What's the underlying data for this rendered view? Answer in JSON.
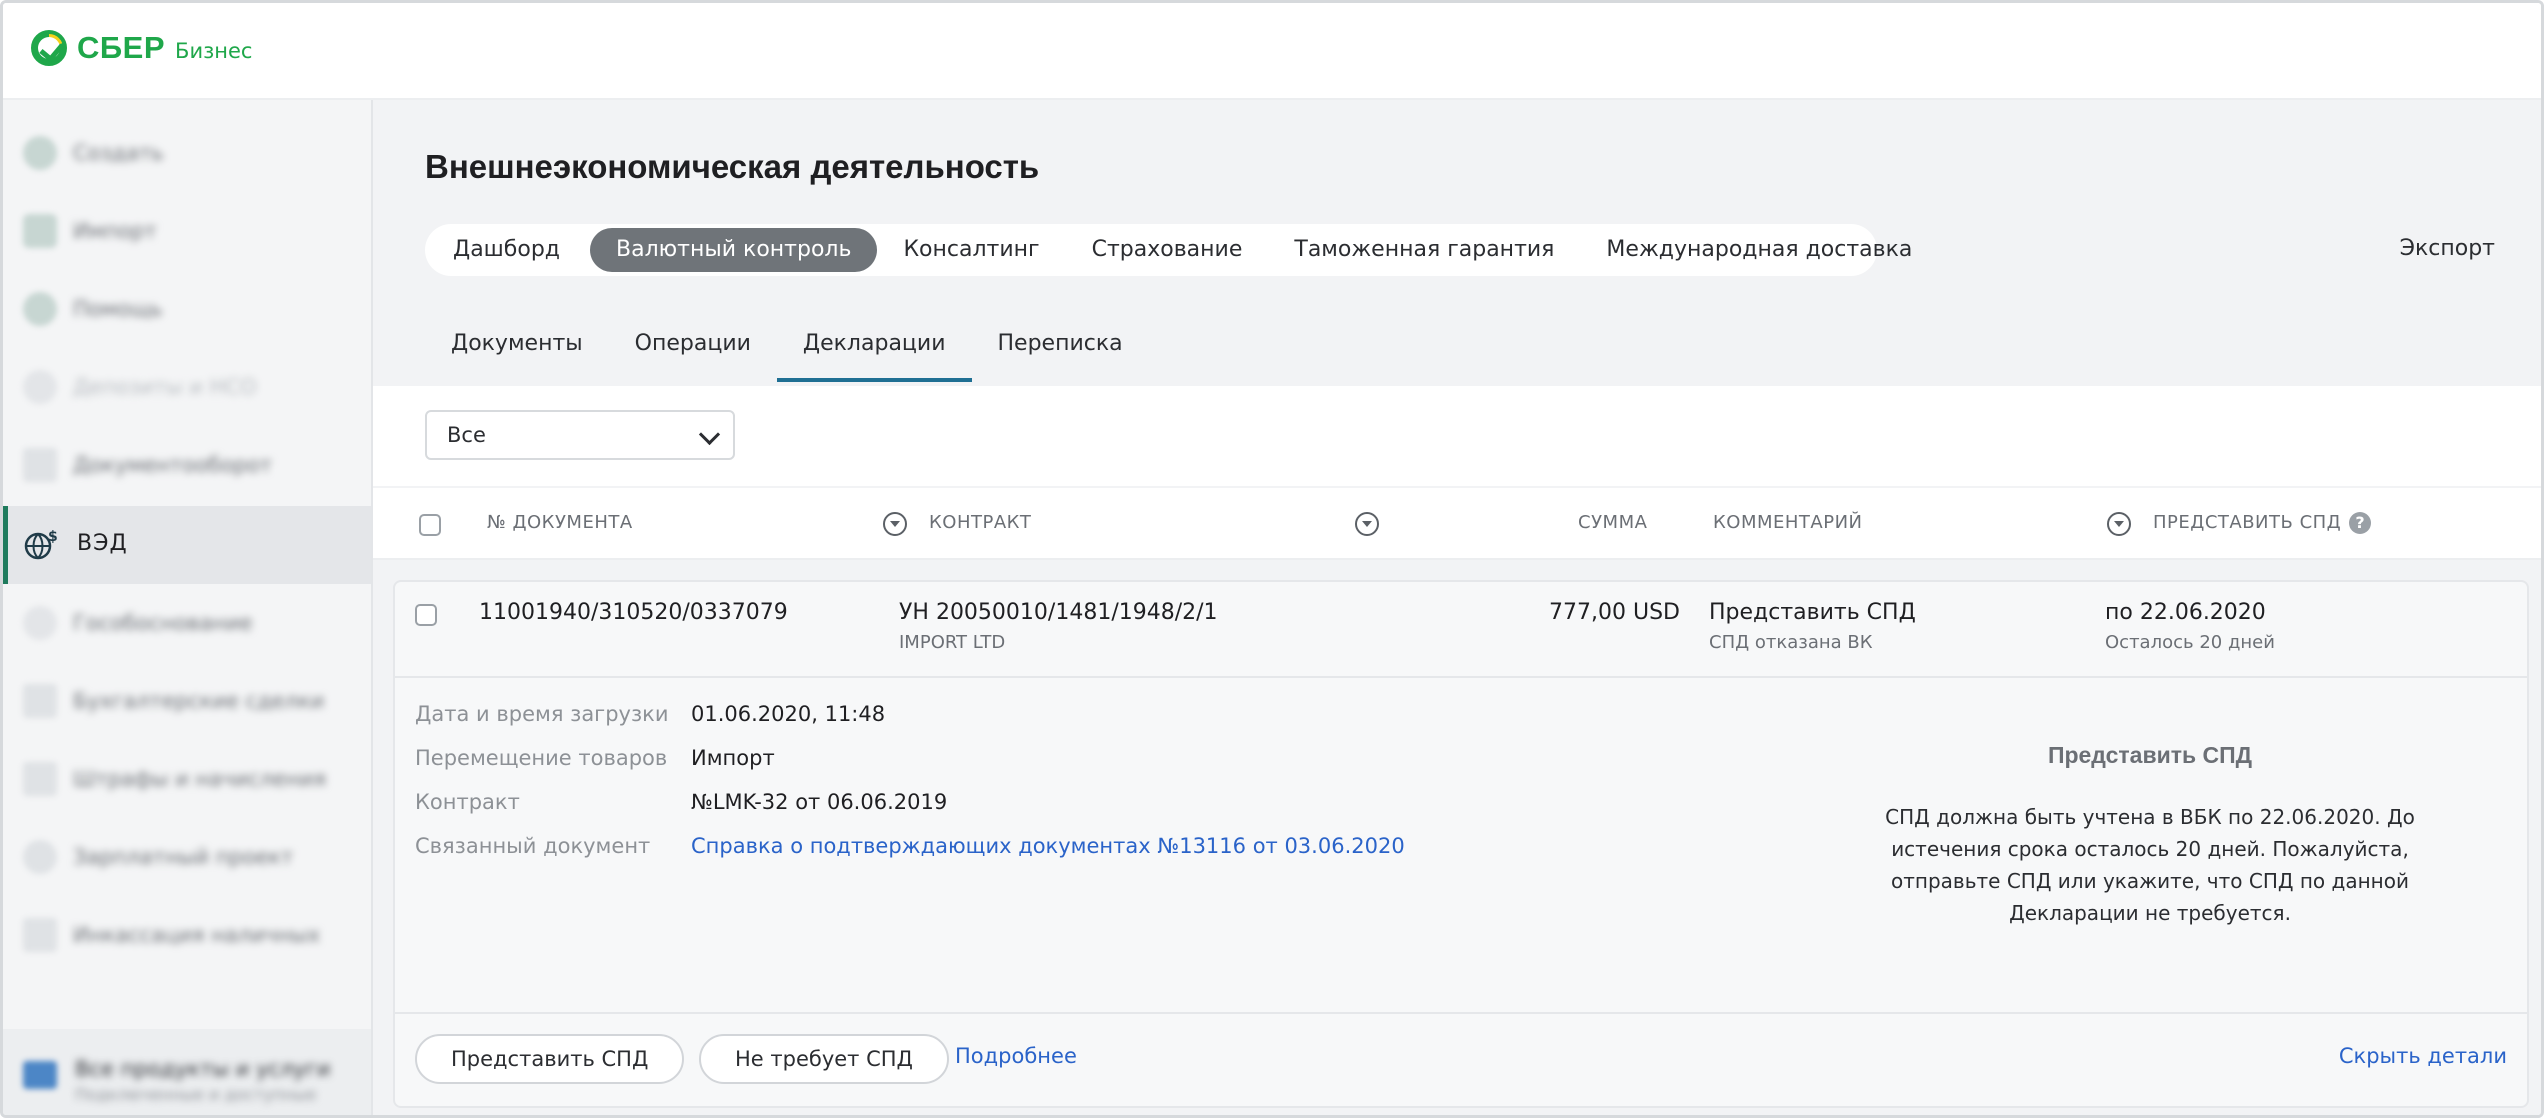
{
  "header": {
    "logo_text": "СБЕР",
    "logo_sub": "Бизнес"
  },
  "sidebar": {
    "items": [
      {
        "label": "Создать",
        "icon": "plus-icon"
      },
      {
        "label": "Импорт",
        "icon": "import-icon"
      },
      {
        "label": "Помощь",
        "icon": "help-icon"
      },
      {
        "label": "Депозиты и НСО",
        "icon": "deposit-icon"
      },
      {
        "label": "Документооборот",
        "icon": "documents-icon"
      },
      {
        "label": "ВЭД",
        "icon": "globe-currency-icon",
        "active": true
      },
      {
        "label": "Гособоснование",
        "icon": "gov-icon"
      },
      {
        "label": "Бухгалтерские сделки",
        "icon": "accounting-icon"
      },
      {
        "label": "Штрафы и начисления",
        "icon": "fines-icon"
      },
      {
        "label": "Зарплатный проект",
        "icon": "salary-icon"
      },
      {
        "label": "Инкассация наличных",
        "icon": "cash-icon"
      }
    ],
    "bottom": {
      "title": "Все продукты и услуги",
      "subtitle": "Подключенные и доступные",
      "icon": "cart-icon"
    }
  },
  "page": {
    "title": "Внешнеэкономическая деятельность",
    "tabs": [
      "Дашборд",
      "Валютный контроль",
      "Консалтинг",
      "Страхование",
      "Таможенная гарантия",
      "Международная доставка"
    ],
    "active_tab": "Валютный контроль",
    "export_label": "Экспорт",
    "subtabs": [
      "Документы",
      "Операции",
      "Декларации",
      "Переписка"
    ],
    "active_subtab": "Декларации",
    "filter": {
      "value": "Все"
    }
  },
  "table": {
    "headers": {
      "doc_number": "№ ДОКУМЕНТА",
      "contract": "КОНТРАКТ",
      "amount": "СУММА",
      "comment": "КОММЕНТАРИЙ",
      "spd": "ПРЕДСТАВИТЬ СПД"
    },
    "row": {
      "doc_number": "11001940/310520/0337079",
      "contract": "УН 20050010/1481/1948/2/1",
      "contract_sub": "IMPORT LTD",
      "amount": "777,00 USD",
      "comment": "Представить СПД",
      "comment_sub": "СПД отказана ВК",
      "deadline": "по 22.06.2020",
      "deadline_sub": "Осталось 20 дней"
    },
    "details": {
      "labels": [
        "Дата и время загрузки",
        "Перемещение товаров",
        "Контракт",
        "Связанный документ"
      ],
      "values": [
        "01.06.2020, 11:48",
        "Импорт",
        "№LMK-32 от 06.06.2019",
        "Справка о подтверждающих документах №13116 от 03.06.2020"
      ]
    },
    "spd_panel": {
      "title": "Представить СПД",
      "text": "СПД должна быть учтена в ВБК по 22.06.2020. До истечения срока осталось 20 дней. Пожалуйста, отправьте СПД или укажите, что СПД по данной Декларации не требуется."
    },
    "actions": {
      "submit": "Представить СПД",
      "not_required": "Не требует СПД",
      "more": "Подробнее",
      "hide": "Скрыть детали"
    }
  },
  "colors": {
    "brand_green": "#1fa74a",
    "active_tab_bg": "#6f7479",
    "link_blue": "#2a63c9",
    "subtab_underline": "#1f6f93"
  }
}
